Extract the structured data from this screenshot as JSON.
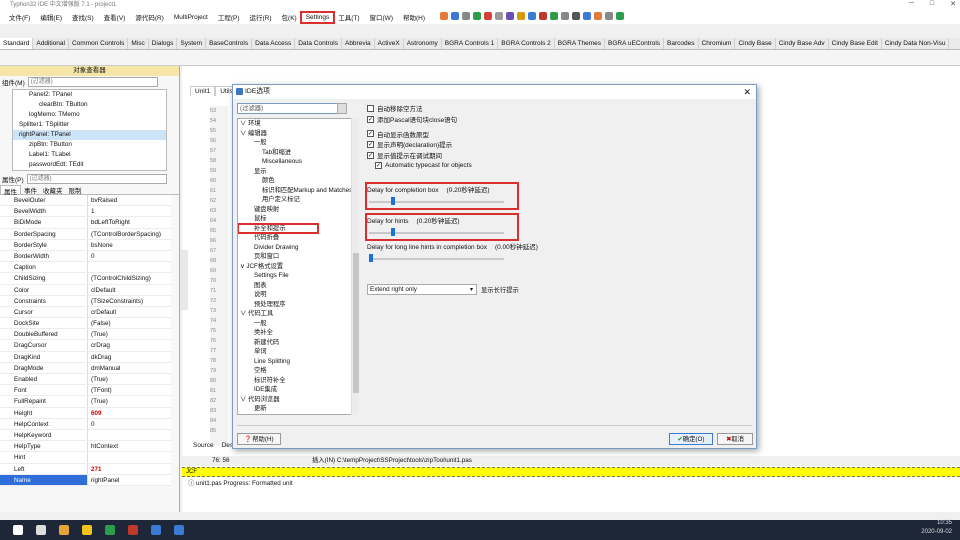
{
  "window": {
    "title": "Typhon32 IDE 中文增强版 7.1 - project1"
  },
  "menu": [
    {
      "label": "文件(F)"
    },
    {
      "label": "编辑(E)"
    },
    {
      "label": "查找(S)"
    },
    {
      "label": "查看(V)"
    },
    {
      "label": "源代码(R)"
    },
    {
      "label": "MultiProject"
    },
    {
      "label": "工程(P)"
    },
    {
      "label": "运行(R)"
    },
    {
      "label": "包(K)"
    },
    {
      "label": "Settings",
      "highlight": true
    },
    {
      "label": "工具(T)"
    },
    {
      "label": "窗口(W)"
    },
    {
      "label": "帮助(H)"
    }
  ],
  "palette_tabs": [
    "Standard",
    "Additional",
    "Common Controls",
    "Misc",
    "Dialogs",
    "System",
    "BaseControls",
    "Data Access",
    "Data Controls",
    "Abbrevia",
    "ActiveX",
    "Astronomy",
    "BGRA Controls 1",
    "BGRA Controls 2",
    "BGRA Themes",
    "BGRA uEControls",
    "Barcodes",
    "Chromium",
    "Cindy Base",
    "Cindy Base Adv",
    "Cindy Base Edit",
    "Cindy Data Non-Visu"
  ],
  "inspector": {
    "header": "对象查看器",
    "components_label": "组件(M)",
    "filter_placeholder": "(过滤器)",
    "tree": [
      {
        "label": "Panel2: TPanel",
        "level": 1
      },
      {
        "label": "clearBtn: TButton",
        "level": 2
      },
      {
        "label": "logMemo: TMemo",
        "level": 1
      },
      {
        "label": "Splitter1: TSplitter",
        "level": 0
      },
      {
        "label": "rightPanel: TPanel",
        "level": 0,
        "selected": true
      },
      {
        "label": "zipBtn: TButton",
        "level": 1
      },
      {
        "label": "Label1: TLabel",
        "level": 1
      },
      {
        "label": "passwordEdt: TEdit",
        "level": 1
      }
    ],
    "props_label": "属性(P)",
    "tabs": [
      "属性",
      "事件",
      "收藏夹",
      "限制"
    ],
    "properties": [
      {
        "k": "BevelOuter",
        "v": "bvRaised"
      },
      {
        "k": "BevelWidth",
        "v": "1"
      },
      {
        "k": "BiDiMode",
        "v": "bdLeftToRight"
      },
      {
        "k": "BorderSpacing",
        "v": "(TControlBorderSpacing)"
      },
      {
        "k": "BorderStyle",
        "v": "bsNone"
      },
      {
        "k": "BorderWidth",
        "v": "0"
      },
      {
        "k": "Caption",
        "v": ""
      },
      {
        "k": "ChildSizing",
        "v": "(TControlChildSizing)"
      },
      {
        "k": "Color",
        "v": "clDefault"
      },
      {
        "k": "Constraints",
        "v": "(TSizeConstraints)"
      },
      {
        "k": "Cursor",
        "v": "crDefault"
      },
      {
        "k": "DockSite",
        "v": "(False)"
      },
      {
        "k": "DoubleBuffered",
        "v": "(True)"
      },
      {
        "k": "DragCursor",
        "v": "crDrag"
      },
      {
        "k": "DragKind",
        "v": "dkDrag"
      },
      {
        "k": "DragMode",
        "v": "dmManual"
      },
      {
        "k": "Enabled",
        "v": "(True)"
      },
      {
        "k": "Font",
        "v": "(TFont)"
      },
      {
        "k": "FullRepaint",
        "v": "(True)"
      },
      {
        "k": "Height",
        "v": "609",
        "red": true
      },
      {
        "k": "HelpContext",
        "v": "0"
      },
      {
        "k": "HelpKeyword",
        "v": ""
      },
      {
        "k": "HelpType",
        "v": "htContext"
      },
      {
        "k": "Hint",
        "v": ""
      },
      {
        "k": "Left",
        "v": "271",
        "red": true
      },
      {
        "k": "Name",
        "v": "rightPanel",
        "selected": true
      }
    ]
  },
  "editor": {
    "tabs": [
      "Unit1",
      "UtilsU"
    ],
    "bottom_tabs": [
      "Source",
      "Desi"
    ],
    "cursor_pos": "76: 56",
    "status_path": "插入(IN) C:\\tempProject\\SSProject\\tools\\zipTool\\unit1.pas",
    "jcf_label": "JCF",
    "message": "unit1.pas Progress: Formatted unit",
    "gutter_lines": [
      "53",
      "54",
      "55",
      "56",
      "57",
      "58",
      "59",
      "60",
      "61",
      "62",
      "63",
      "64",
      "65",
      "66",
      "67",
      "68",
      "69",
      "70",
      "71",
      "72",
      "73",
      "74",
      "75",
      "76",
      "77",
      "78",
      "79",
      "80",
      "81",
      "82",
      "83",
      "84",
      "85"
    ]
  },
  "dialog": {
    "title": "IDE选项",
    "filter_placeholder": "(过滤器)",
    "tree": [
      {
        "label": "环境",
        "level": 0
      },
      {
        "label": "编辑器",
        "level": 0
      },
      {
        "label": "一般",
        "level": 1
      },
      {
        "label": "Tab和缩进",
        "level": 2
      },
      {
        "label": "Miscellaneous",
        "level": 2
      },
      {
        "label": "显示",
        "level": 1
      },
      {
        "label": "颜色",
        "level": 2
      },
      {
        "label": "标识和匹配Markup and Matches",
        "level": 2
      },
      {
        "label": "用户定义标记",
        "level": 2
      },
      {
        "label": "键盘映射",
        "level": 1
      },
      {
        "label": "鼠标",
        "level": 1
      },
      {
        "label": "补全和提示",
        "level": 1,
        "highlight": true
      },
      {
        "label": "代码折叠",
        "level": 1
      },
      {
        "label": "Divider Drawing",
        "level": 1
      },
      {
        "label": "页和窗口",
        "level": 1
      },
      {
        "label": "JCF格式设置",
        "level": 0
      },
      {
        "label": "Settings File",
        "level": 1
      },
      {
        "label": "图表",
        "level": 1
      },
      {
        "label": "说明",
        "level": 1
      },
      {
        "label": "预处理程序",
        "level": 1
      },
      {
        "label": "代码工具",
        "level": 0
      },
      {
        "label": "一般",
        "level": 1
      },
      {
        "label": "类补全",
        "level": 1
      },
      {
        "label": "新建代码",
        "level": 1
      },
      {
        "label": "单词",
        "level": 1
      },
      {
        "label": "Line Splitting",
        "level": 1
      },
      {
        "label": "空格",
        "level": 1
      },
      {
        "label": "标识符补全",
        "level": 1
      },
      {
        "label": "IDE集成",
        "level": 1
      },
      {
        "label": "代码浏览器",
        "level": 0
      },
      {
        "label": "更新",
        "level": 1
      }
    ],
    "checkboxes": [
      {
        "label": "自动移除空方法",
        "checked": false
      },
      {
        "label": "添加Pascal语句块close语句",
        "checked": true
      },
      {
        "label": "自动显示函数原型",
        "checked": true
      },
      {
        "label": "显示声明(declaration)提示",
        "checked": true
      },
      {
        "label": "显示值提示在调试期间",
        "checked": true
      },
      {
        "label": "Automatic typecast for objects",
        "checked": true
      }
    ],
    "sliders": [
      {
        "label": "Delay for completion box",
        "value_text": "(0.20秒钟延迟)",
        "value": 0.2,
        "highlight": true
      },
      {
        "label": "Delay for hints",
        "value_text": "(0.20秒钟延迟)",
        "value": 0.2,
        "highlight": true
      },
      {
        "label": "Delay for long line hints in completion box",
        "value_text": "(0.00秒钟延迟)",
        "value": 0.0,
        "highlight": false
      }
    ],
    "dropdown_value": "Extend right only",
    "dropdown_label": "显示长行提示",
    "help_button": "帮助(H)",
    "ok_button": "确定(O)",
    "cancel_button": "取消"
  },
  "tray": {
    "time": "10:35",
    "date": "2020-09-02"
  },
  "colors": {
    "highlight_red": "#d9302d",
    "accent_blue": "#1a73d9",
    "jcf_yellow": "#ffff00"
  }
}
